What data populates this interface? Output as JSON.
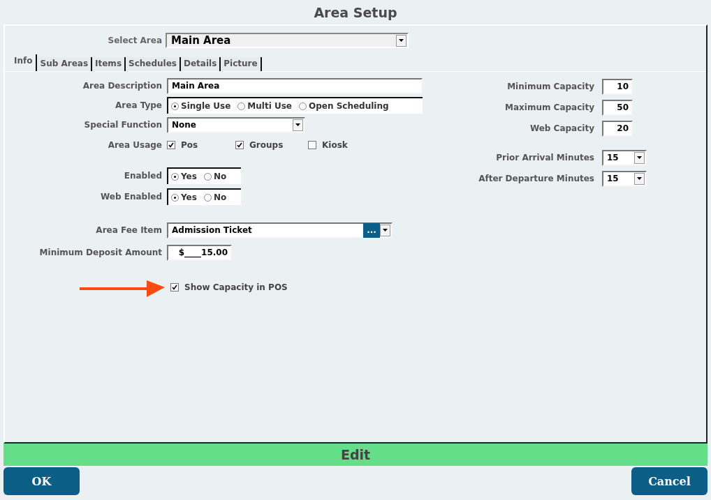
{
  "window": {
    "title": "Area Setup"
  },
  "select_area": {
    "label": "Select Area",
    "value": "Main Area"
  },
  "tabs": [
    {
      "label": "Info",
      "selected": true
    },
    {
      "label": "Sub Areas",
      "selected": false
    },
    {
      "label": "Items",
      "selected": false
    },
    {
      "label": "Schedules",
      "selected": false
    },
    {
      "label": "Details",
      "selected": false
    },
    {
      "label": "Picture",
      "selected": false
    }
  ],
  "left_fields": [
    {
      "kind": "text",
      "label": "Area Description",
      "value": "Main Area"
    },
    {
      "kind": "radio",
      "label": "Area Type",
      "options": [
        {
          "label": "Single Use",
          "selected": true
        },
        {
          "label": "Multi Use",
          "selected": false
        },
        {
          "label": "Open Scheduling",
          "selected": false
        }
      ]
    },
    {
      "kind": "select",
      "label": "Special Function",
      "value": "None"
    },
    {
      "kind": "checks",
      "label": "Area Usage",
      "options": [
        {
          "label": "Pos",
          "checked": true
        },
        {
          "label": "Groups",
          "checked": true
        },
        {
          "label": "Kiosk",
          "checked": false
        }
      ]
    },
    {
      "kind": "radio",
      "label": "Enabled",
      "options": [
        {
          "label": "Yes",
          "selected": true
        },
        {
          "label": "No",
          "selected": false
        }
      ]
    },
    {
      "kind": "radio",
      "label": "Web Enabled",
      "options": [
        {
          "label": "Yes",
          "selected": true
        },
        {
          "label": "No",
          "selected": false
        }
      ]
    },
    {
      "kind": "lookup",
      "label": "Area Fee Item",
      "value": "Admission Ticket",
      "button": "..."
    },
    {
      "kind": "money",
      "label": "Minimum Deposit Amount",
      "value": "$____15.00"
    },
    {
      "kind": "checkbox",
      "label": "Show Capacity in POS",
      "checked": true
    }
  ],
  "right_fields": [
    {
      "kind": "number",
      "label": "Minimum Capacity",
      "value": "10"
    },
    {
      "kind": "number",
      "label": "Maximum Capacity",
      "value": "50"
    },
    {
      "kind": "number",
      "label": "Web Capacity",
      "value": "20"
    },
    {
      "kind": "select",
      "label": "Prior Arrival Minutes",
      "value": "15"
    },
    {
      "kind": "select",
      "label": "After Departure Minutes",
      "value": "15"
    }
  ],
  "status_bar": {
    "text": "Edit"
  },
  "buttons": [
    {
      "label": "OK"
    },
    {
      "label": "Cancel"
    }
  ]
}
